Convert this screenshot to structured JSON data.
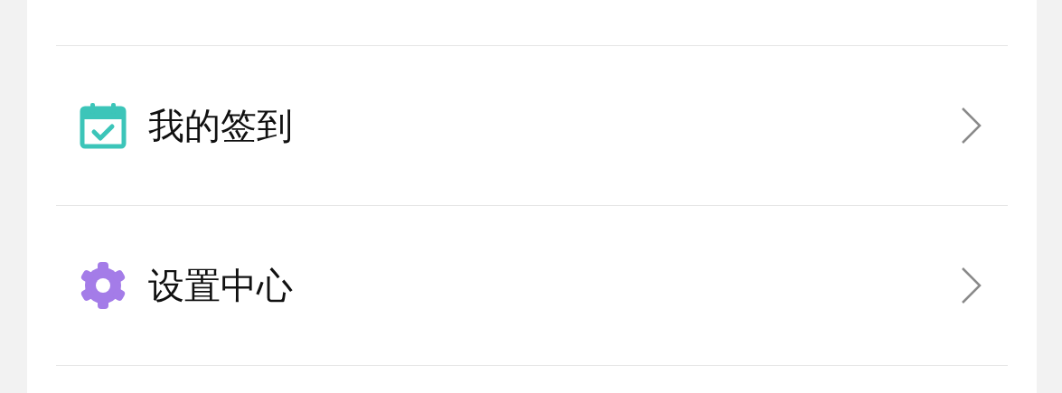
{
  "menu": {
    "items": [
      {
        "kind": "checkin",
        "label": "我的签到"
      },
      {
        "kind": "settings",
        "label": "设置中心"
      }
    ]
  }
}
